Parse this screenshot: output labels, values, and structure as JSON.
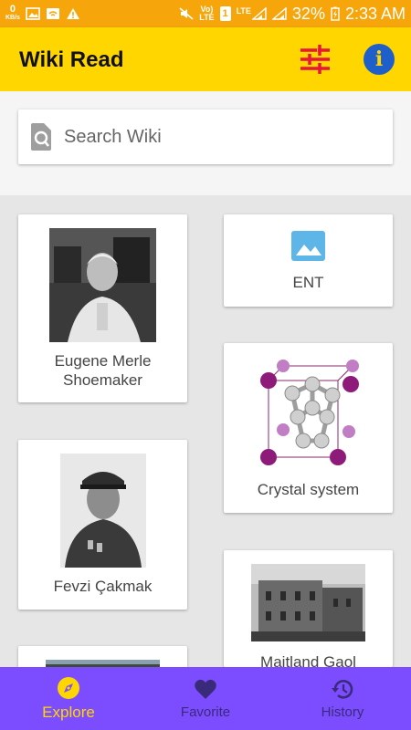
{
  "status_bar": {
    "speed": "0",
    "speed_unit": "KB/s",
    "volte": "Vo)",
    "lte_small": "LTE",
    "sim": "1",
    "lte": "LTE",
    "battery": "32%",
    "time": "2:33 AM"
  },
  "appbar": {
    "title": "Wiki Read",
    "accent_color": "#ffd600",
    "filter_icon": "tune-icon",
    "info_icon": "info-icon",
    "info_glyph": "i"
  },
  "search": {
    "placeholder": "Search Wiki"
  },
  "cards": [
    {
      "title": "Eugene Merle Shoemaker",
      "image": "portrait-photo"
    },
    {
      "title": "ENT",
      "image": "image-placeholder-icon"
    },
    {
      "title": "Crystal system",
      "image": "crystal-lattice"
    },
    {
      "title": "Fevzi Çakmak",
      "image": "portrait-photo"
    },
    {
      "title": "Maitland Gaol",
      "image": "building-photo"
    }
  ],
  "bottom_nav": {
    "background": "#7c4dff",
    "items": [
      {
        "label": "Explore",
        "icon": "compass-icon",
        "active": true
      },
      {
        "label": "Favorite",
        "icon": "heart-icon",
        "active": false
      },
      {
        "label": "History",
        "icon": "history-icon",
        "active": false
      }
    ]
  }
}
